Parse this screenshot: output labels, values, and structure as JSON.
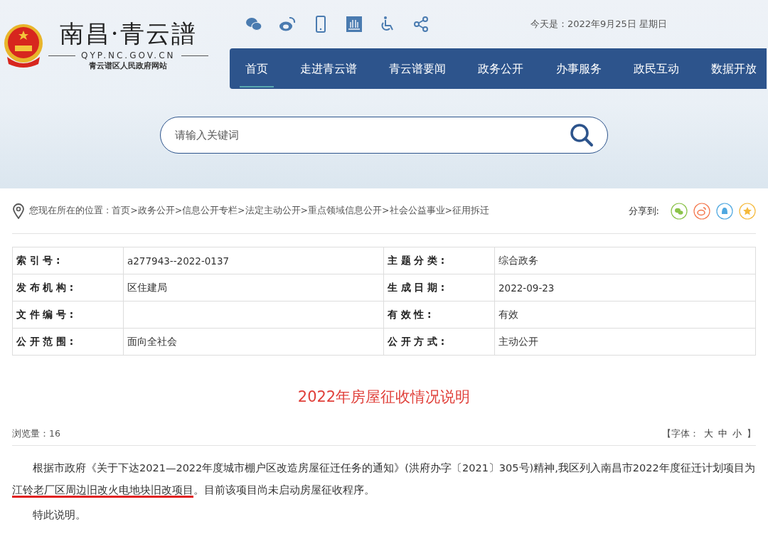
{
  "site": {
    "logo_title": "南昌·青云譜",
    "logo_domain": "QYP.NC.GOV.CN",
    "logo_subtitle": "青云谱区人民政府网站"
  },
  "date_text": "今天是：2022年9月25日 星期日",
  "nav": [
    {
      "label": "首页",
      "selected": true
    },
    {
      "label": "走进青云谱",
      "selected": false
    },
    {
      "label": "青云谱要闻",
      "selected": false
    },
    {
      "label": "政务公开",
      "selected": false
    },
    {
      "label": "办事服务",
      "selected": false
    },
    {
      "label": "政民互动",
      "selected": false
    },
    {
      "label": "数据开放",
      "selected": false
    }
  ],
  "search": {
    "placeholder": "请输入关键词"
  },
  "breadcrumb": "您现在所在的位置 : 首页>政务公开>信息公开专栏>法定主动公开>重点领域信息公开>社会公益事业>征用拆迁",
  "share": {
    "label": "分享到:",
    "targets": [
      {
        "kind": "wechat",
        "color": "#8bc34a"
      },
      {
        "kind": "weibo",
        "color": "#f4764b"
      },
      {
        "kind": "qq",
        "color": "#4fa8e0"
      },
      {
        "kind": "star",
        "color": "#f5b93b"
      }
    ]
  },
  "info_table": [
    {
      "label_1": "索 引 号 :",
      "value_1": "a277943--2022-0137",
      "label_2": "主 题 分 类 :",
      "value_2": "综合政务"
    },
    {
      "label_1": "发 布 机 构 :",
      "value_1": "区住建局",
      "label_2": "生 成 日 期 :",
      "value_2": "2022-09-23"
    },
    {
      "label_1": "文 件 编 号 :",
      "label_2": "有 效 性 :",
      "value_2": "有效"
    },
    {
      "label_1": "公 开 范 围 :",
      "value_1": "面向全社会",
      "label_2": "公 开 方 式 :",
      "value_2": "主动公开"
    }
  ],
  "article": {
    "title": "2022年房屋征收情况说明",
    "views": "浏览量：16",
    "font_size": {
      "open": "【字体：",
      "options": [
        "大",
        "中",
        "小"
      ],
      "close": "】"
    },
    "paragraphs": [
      [
        {
          "text": "根据市政府《关于下达2021—2022年度城市棚户区改造房屋征迁任务的通知》(洪府办字〔2021〕305号)精神,我区列入南昌市2022年度征迁计划项目为",
          "underlined": false
        },
        {
          "text": "江铃老厂区周边旧改火电地块旧改项目",
          "underlined": true
        },
        {
          "text": "。目前该项目尚未启动房屋征收程序。",
          "underlined": false
        }
      ],
      [
        {
          "text": "特此说明。",
          "underlined": false
        }
      ]
    ]
  }
}
